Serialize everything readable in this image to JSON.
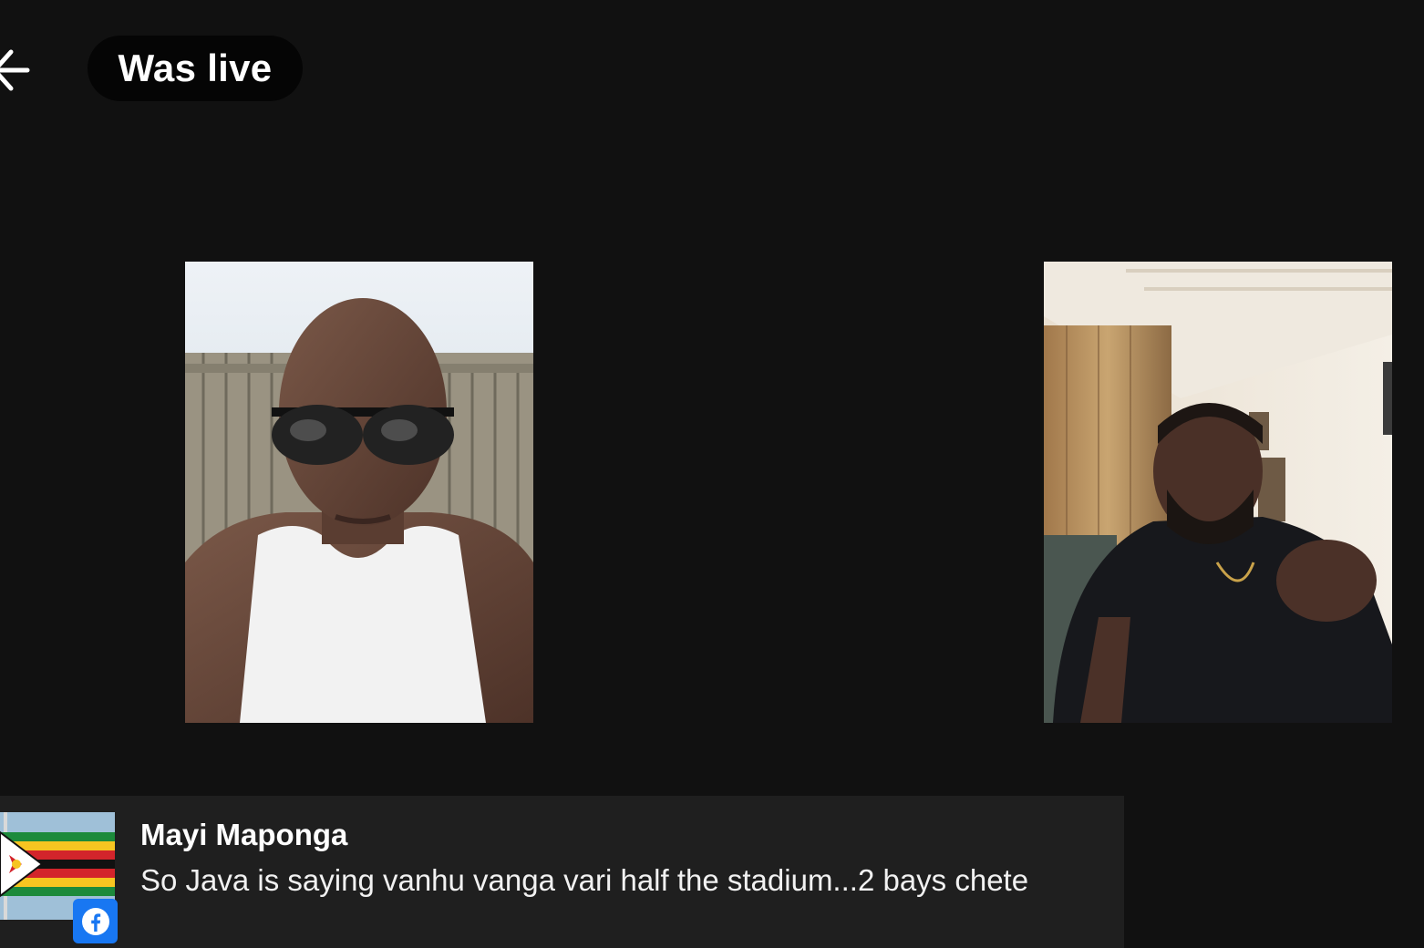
{
  "header": {
    "back_icon": "arrow-left-icon",
    "status_label": "Was live"
  },
  "participants": [
    {
      "tile": "participant-video-left"
    },
    {
      "tile": "participant-video-right"
    }
  ],
  "comment": {
    "author": "Mayi Maponga",
    "text": "So Java is saying vanhu vanga vari half the stadium...2 bays chete",
    "avatar_icon": "zimbabwe-flag-avatar",
    "platform_icon": "facebook-icon",
    "platform_color": "#1877f2"
  },
  "colors": {
    "background": "#111111",
    "comment_bar": "#1f1f1f",
    "pill": "#050505"
  }
}
